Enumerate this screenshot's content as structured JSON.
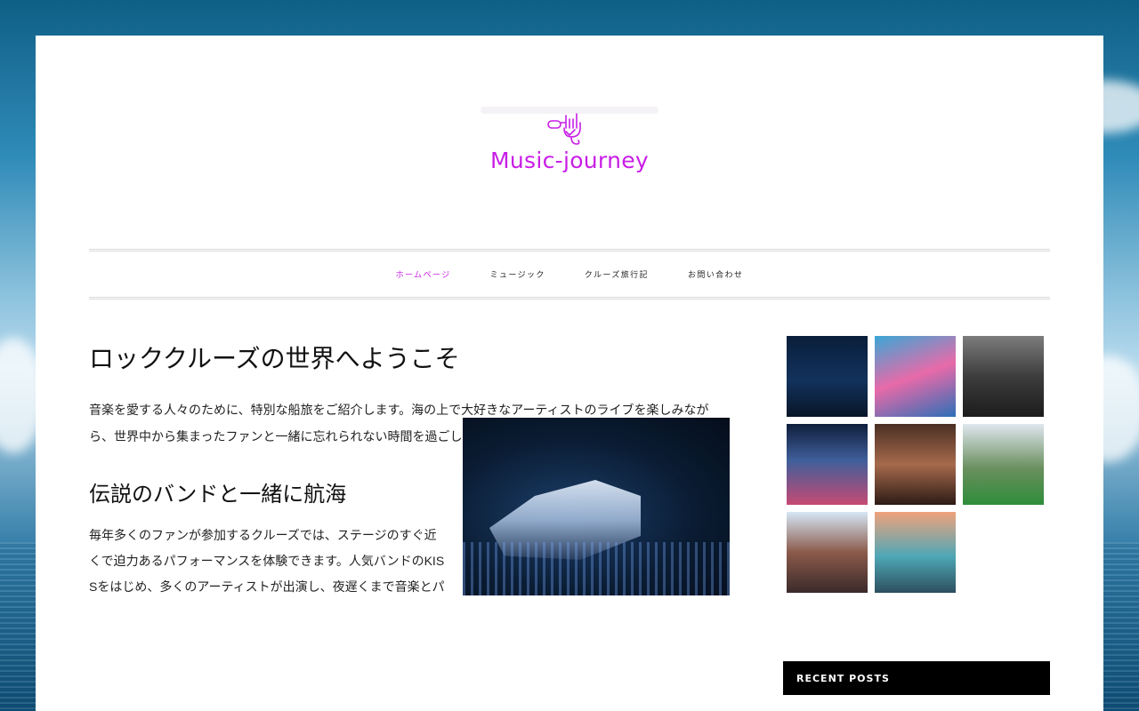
{
  "site": {
    "logo_text": "Music-journey"
  },
  "nav": {
    "items": [
      {
        "label": "ホームページ",
        "active": true
      },
      {
        "label": "ミュージック",
        "active": false
      },
      {
        "label": "クルーズ旅行記",
        "active": false
      },
      {
        "label": "お問い合わせ",
        "active": false
      }
    ]
  },
  "article": {
    "title": "ロッククルーズの世界へようこそ",
    "paragraph1": "音楽を愛する人々のために、特別な船旅をご紹介します。海の上で大好きなアーティストのライブを楽しみながら、世界中から集まったファンと一緒に忘れられない時間を過ごしましょう。このブログでは、ロッククルーズの魅力や旅のヒントをたくさんお届けします。船内の雰囲気やおすすめのイベントもぜひチェックしてください。",
    "subtitle": "伝説のバンドと一緒に航海",
    "paragraph2": "毎年多くのファンが参加するクルーズでは、ステージのすぐ近くで迫力あるパフォーマンスを体験できます。人気バンドのKISSをはじめ、多くのアーティストが出演し、夜遅くまで音楽とパーティーが続きます。デッキでの野外ライブは特に人気があります。"
  },
  "gallery": {
    "images": [
      "cruise-ship-night",
      "fans-with-banner",
      "concert-crowd",
      "stage-lights-crowd",
      "theater-hall",
      "deck-party-green",
      "pool-deck-concert",
      "sunset-pool-deck"
    ]
  },
  "sidebar": {
    "recent_posts_label": "RECENT POSTS"
  },
  "colors": {
    "accent": "#c81ee6",
    "widget_bg": "#000000",
    "page_bg": "#ffffff"
  }
}
